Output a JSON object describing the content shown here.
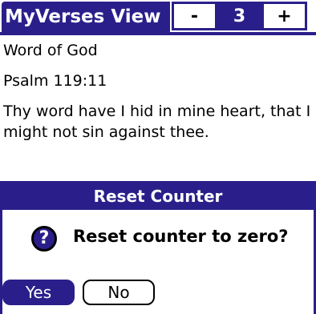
{
  "app": {
    "title": "MyVerses View",
    "minus_label": "-",
    "counter_value": "3",
    "plus_label": "+"
  },
  "content": {
    "heading": "Word of God",
    "reference": "Psalm 119:11",
    "verse_text": "Thy word have I hid in mine heart, that I might not sin against thee."
  },
  "dialog": {
    "title": "Reset Counter",
    "icon": "question-icon",
    "message": "Reset counter to zero?",
    "yes_label": "Yes",
    "no_label": "No"
  },
  "colors": {
    "accent": "#2a1f8a"
  }
}
